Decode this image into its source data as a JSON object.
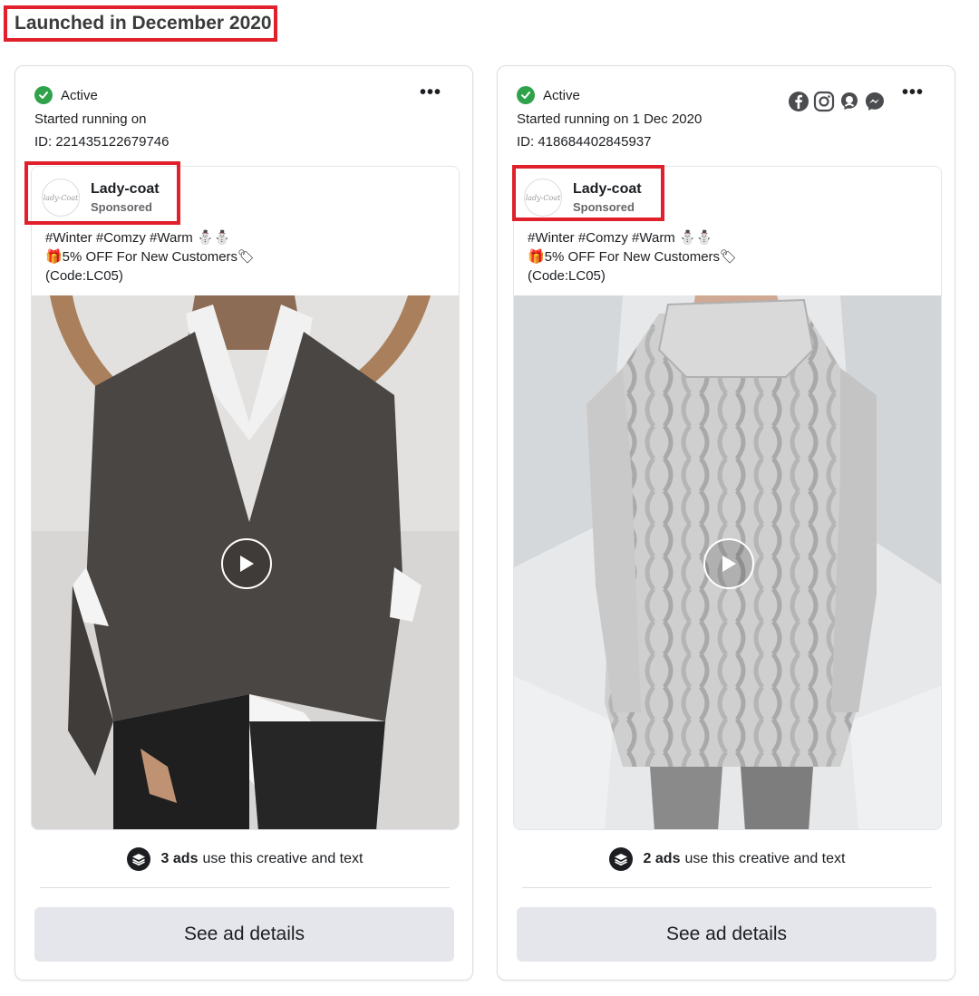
{
  "section_title": "Launched in December 2020",
  "colors": {
    "highlight": "#e0202a",
    "active_green": "#31a24c",
    "button_bg": "#e4e6eb",
    "secondary_text": "#65676b"
  },
  "ads": [
    {
      "status": "Active",
      "started": "Started running on",
      "id": "ID: 221435122679746",
      "platform_icons": [],
      "brand_name": "Lady-coat",
      "sponsored": "Sponsored",
      "body": "#Winter #Comzy #Warm ⛄⛄\n🎁5% OFF For New Customers🏷\n(Code:LC05)",
      "media_type": "video",
      "media_description_icon": "play-icon",
      "count_number": "3 ads",
      "count_text": "use this creative and text",
      "details_label": "See ad details",
      "more_label": "•••"
    },
    {
      "status": "Active",
      "started": "Started running on 1 Dec 2020",
      "id": "ID: 418684402845937",
      "platform_icons": [
        "facebook-icon",
        "instagram-icon",
        "audience-network-icon",
        "messenger-icon"
      ],
      "brand_name": "Lady-coat",
      "sponsored": "Sponsored",
      "body": "#Winter #Comzy #Warm ⛄⛄\n🎁5% OFF For New Customers🏷\n(Code:LC05)",
      "media_type": "video",
      "media_description_icon": "play-icon",
      "count_number": "2 ads",
      "count_text": "use this creative and text",
      "details_label": "See ad details",
      "more_label": "•••"
    }
  ],
  "logo_text": "lady-Coat"
}
